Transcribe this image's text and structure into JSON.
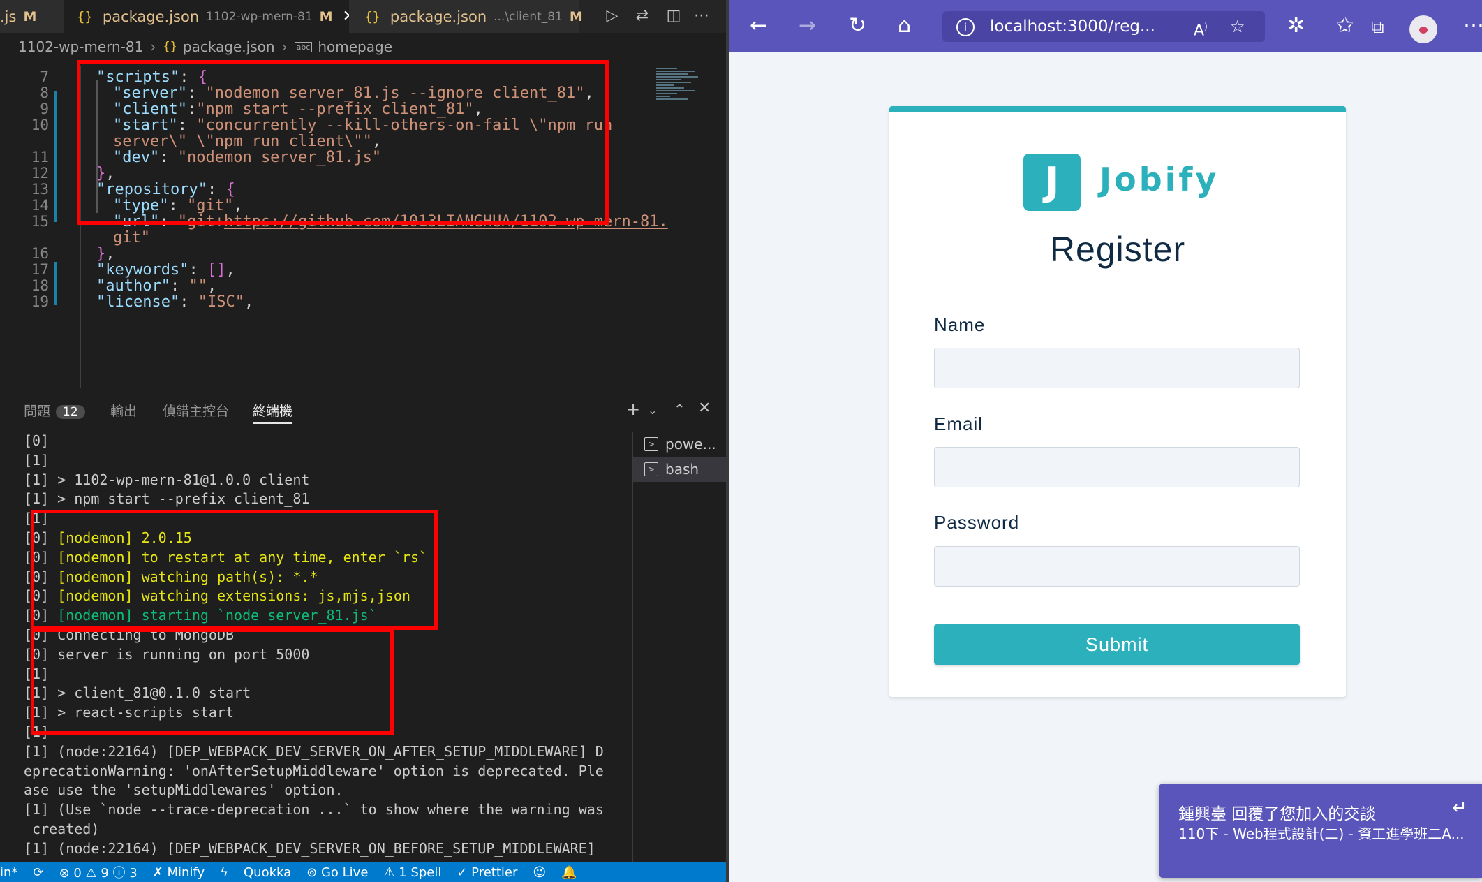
{
  "vscode": {
    "tabs": [
      {
        "label": ".js",
        "modified": "M"
      },
      {
        "label": "package.json",
        "path": "1102-wp-mern-81",
        "modified": "M",
        "close": "✕"
      },
      {
        "label": "package.json",
        "path": "...\\client_81",
        "modified": "M"
      }
    ],
    "breadcrumb": [
      "1102-wp-mern-81",
      "package.json",
      "homepage"
    ],
    "code_lines": [
      {
        "num": "7",
        "text": "\"scripts\": {"
      },
      {
        "num": "8",
        "text": "\"server\": \"nodemon server_81.js --ignore client_81\","
      },
      {
        "num": "9",
        "text": "\"client\":\"npm start --prefix client_81\","
      },
      {
        "num": "10",
        "text": "\"start\": \"concurrently --kill-others-on-fail \\\"npm run"
      },
      {
        "num": "",
        "text": "server\\\" \\\"npm run client\\\"\","
      },
      {
        "num": "11",
        "text": "\"dev\": \"nodemon server_81.js\""
      },
      {
        "num": "12",
        "text": "},"
      },
      {
        "num": "13",
        "text": "\"repository\": {"
      },
      {
        "num": "14",
        "text": "\"type\": \"git\","
      },
      {
        "num": "15",
        "text": "\"url\": \"git+https://github.com/1013LIANGHUA/1102-wp-mern-81."
      },
      {
        "num": "",
        "text": "git\""
      },
      {
        "num": "16",
        "text": "},"
      },
      {
        "num": "17",
        "text": "\"keywords\": [],"
      },
      {
        "num": "18",
        "text": "\"author\": \"\","
      },
      {
        "num": "19",
        "text": "\"license\": \"ISC\","
      }
    ],
    "panel_tabs": {
      "problems": "問題",
      "problems_count": "12",
      "output": "輸出",
      "debug": "偵錯主控台",
      "terminal": "終端機"
    },
    "terminal_list": [
      "powe...",
      "bash"
    ],
    "terminal_lines": [
      "[0]",
      "[1]",
      "[1] > 1102-wp-mern-81@1.0.0 client",
      "[1] > npm start --prefix client_81",
      "[1]",
      "[0] [nodemon] 2.0.15",
      "[0] [nodemon] to restart at any time, enter `rs`",
      "[0] [nodemon] watching path(s): *.*",
      "[0] [nodemon] watching extensions: js,mjs,json",
      "[0] [nodemon] starting `node server_81.js`",
      "[0] Connecting to MongoDB",
      "[0] server is running on port 5000",
      "[1]",
      "[1] > client_81@0.1.0 start",
      "[1] > react-scripts start",
      "[1]",
      "[1] (node:22164) [DEP_WEBPACK_DEV_SERVER_ON_AFTER_SETUP_MIDDLEWARE] D",
      "eprecationWarning: 'onAfterSetupMiddleware' option is deprecated. Ple",
      "ase use the 'setupMiddlewares' option.",
      "[1] (Use `node --trace-deprecation ...` to show where the warning was",
      " created)",
      "[1] (node:22164) [DEP_WEBPACK_DEV_SERVER_ON_BEFORE_SETUP_MIDDLEWARE]"
    ],
    "statusbar": [
      "in*",
      "⟳",
      "⊗ 0 ⚠ 9 ⓘ 3",
      "✗ Minify",
      "ϟ",
      "Quokka",
      "⊚ Go Live",
      "⚠ 1 Spell",
      "✓ Prettier",
      "☺",
      "🔔"
    ]
  },
  "browser": {
    "url": "localhost:3000/reg...",
    "logo_letter": "J",
    "logo_text": "Jobify",
    "title": "Register",
    "fields": [
      {
        "label": "Name",
        "value": ""
      },
      {
        "label": "Email",
        "value": ""
      },
      {
        "label": "Password",
        "value": ""
      }
    ],
    "submit": "Submit"
  },
  "notification": {
    "title": "鍾興臺 回覆了您加入的交談",
    "body": "110下 - Web程式設計(二) - 資工進學班二A..."
  },
  "colors": {
    "accent": "#2cb1bc",
    "browser_bar": "#5a55ba",
    "status_bar": "#007acc",
    "highlight": "#ff0000"
  }
}
